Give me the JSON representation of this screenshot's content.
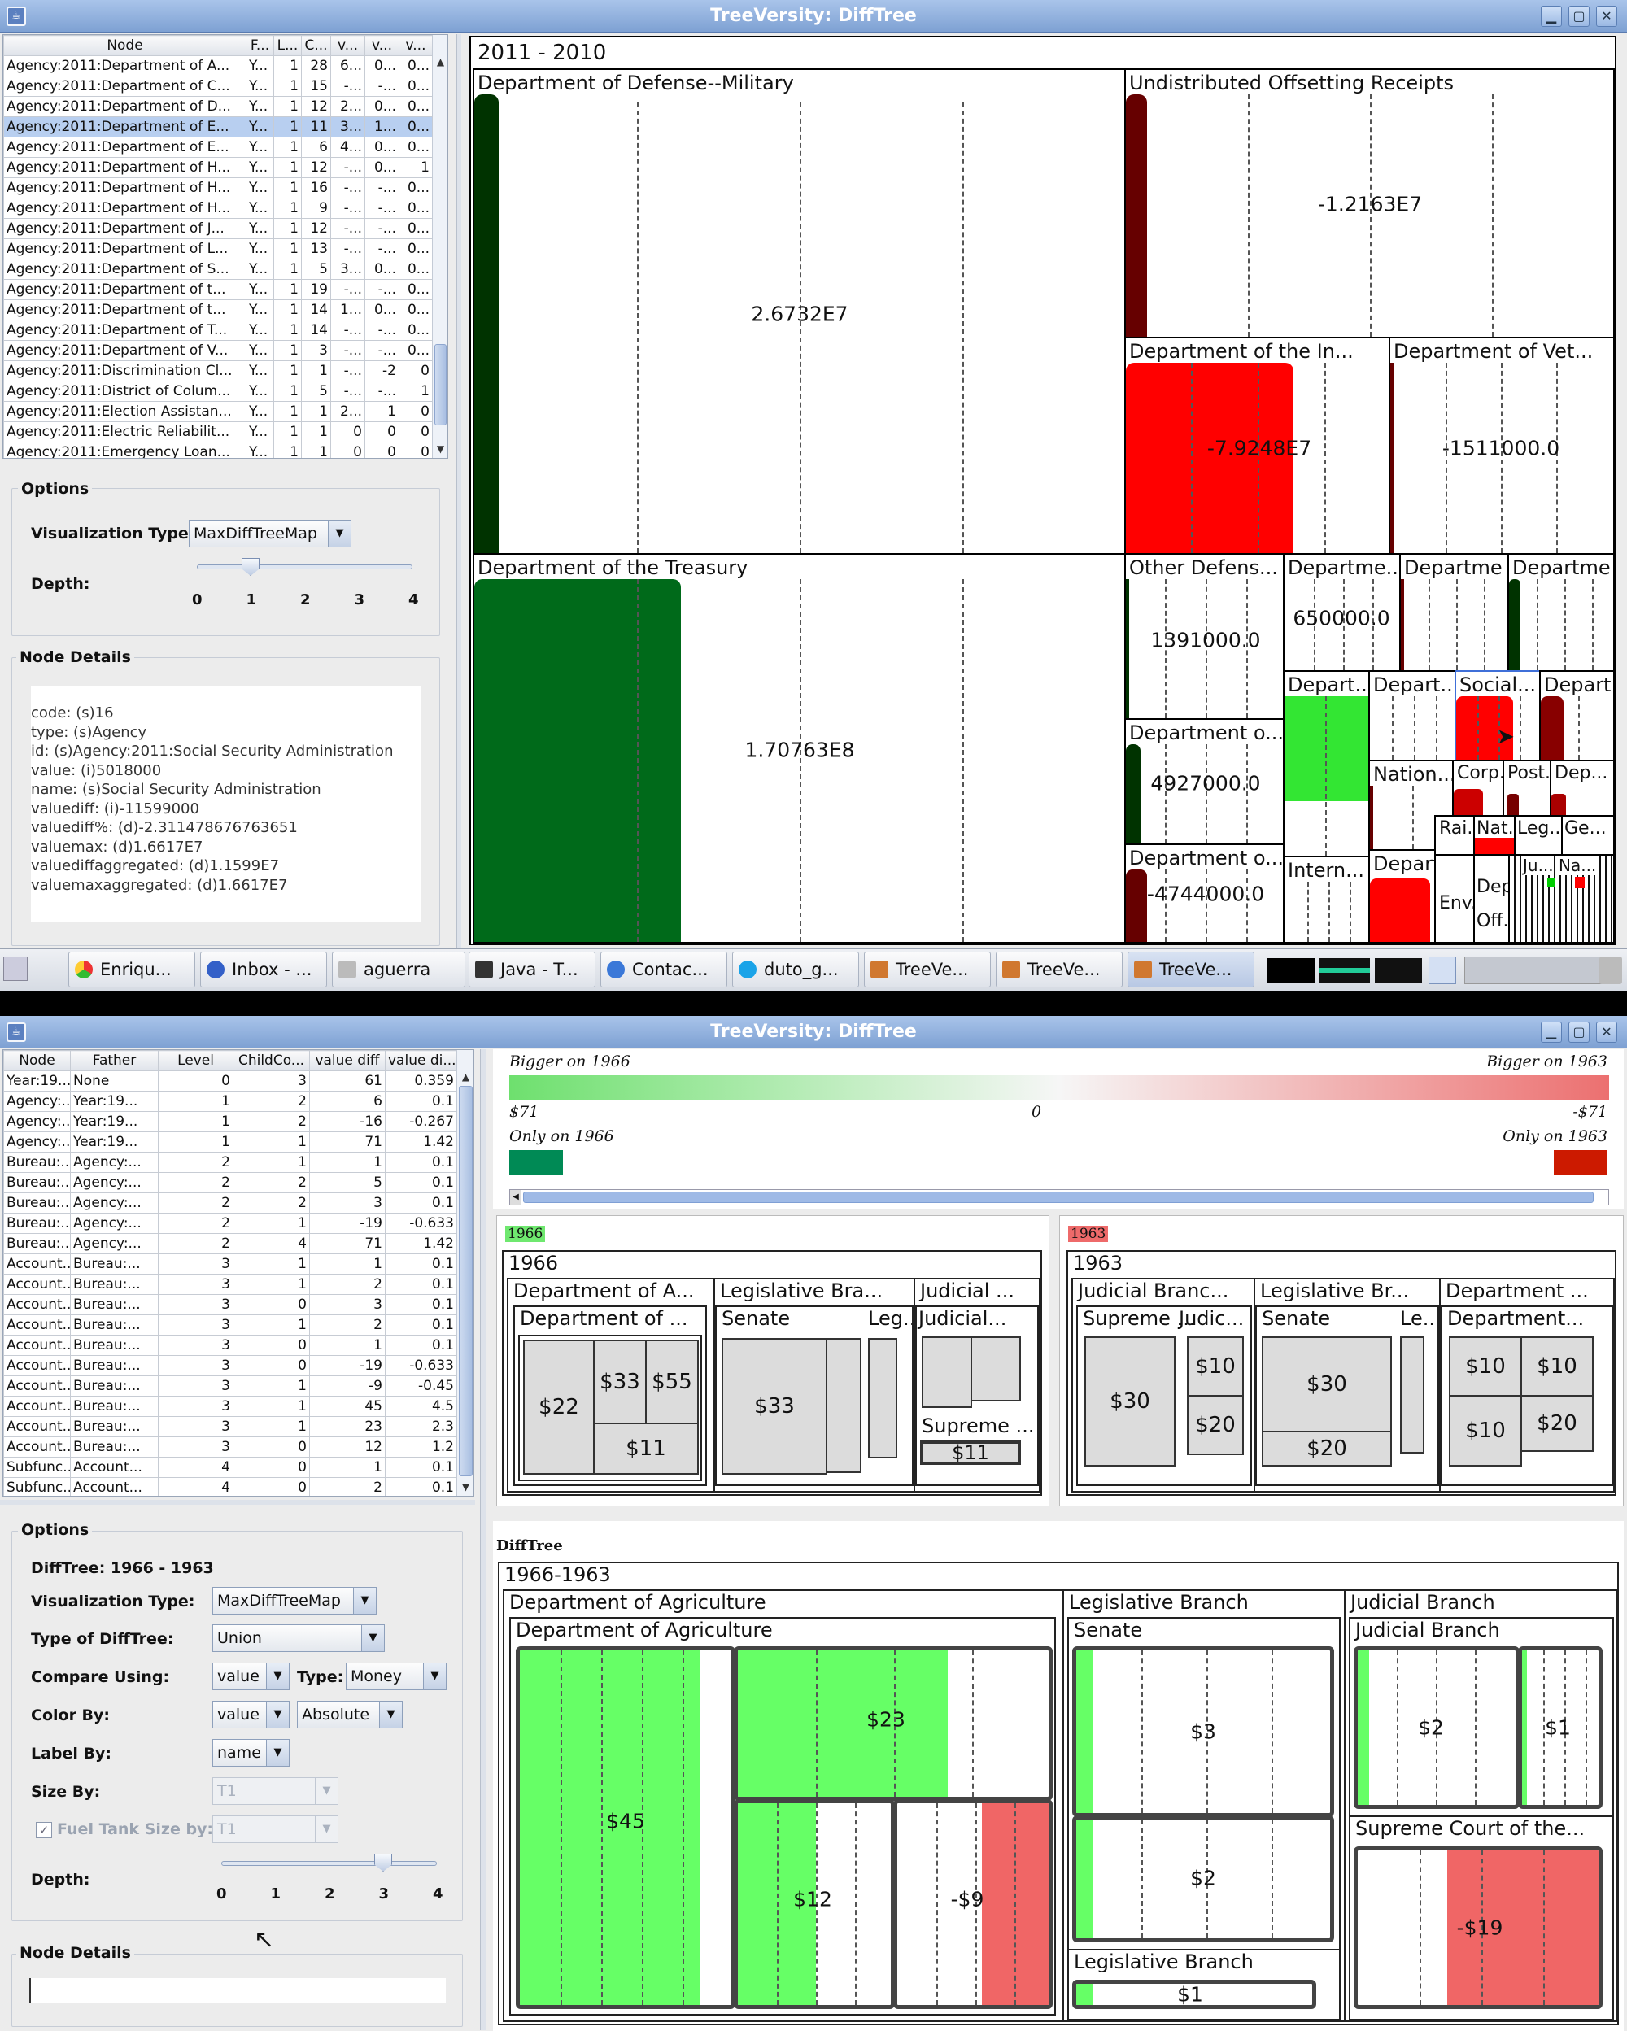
{
  "top_window": {
    "title": "TreeVersity: DiffTree",
    "table": {
      "headers": [
        "Node",
        "F...",
        "L...",
        "C...",
        "v...",
        "v...",
        "v..."
      ],
      "rows": [
        [
          "Agency:2011:Department of A...",
          "Y...",
          "1",
          "28",
          "6...",
          "0...",
          "0..."
        ],
        [
          "Agency:2011:Department of C...",
          "Y...",
          "1",
          "15",
          "-...",
          "-...",
          "0..."
        ],
        [
          "Agency:2011:Department of D...",
          "Y...",
          "1",
          "12",
          "2...",
          "0...",
          "0..."
        ],
        [
          "Agency:2011:Department of E...",
          "Y...",
          "1",
          "11",
          "3...",
          "1...",
          "0..."
        ],
        [
          "Agency:2011:Department of E...",
          "Y...",
          "1",
          "6",
          "4...",
          "0...",
          "0..."
        ],
        [
          "Agency:2011:Department of H...",
          "Y...",
          "1",
          "12",
          "-...",
          "0...",
          "1"
        ],
        [
          "Agency:2011:Department of H...",
          "Y...",
          "1",
          "16",
          "-...",
          "-...",
          "0..."
        ],
        [
          "Agency:2011:Department of H...",
          "Y...",
          "1",
          "9",
          "-...",
          "-...",
          "0..."
        ],
        [
          "Agency:2011:Department of J...",
          "Y...",
          "1",
          "12",
          "-...",
          "-...",
          "0..."
        ],
        [
          "Agency:2011:Department of L...",
          "Y...",
          "1",
          "13",
          "-...",
          "-...",
          "0..."
        ],
        [
          "Agency:2011:Department of S...",
          "Y...",
          "1",
          "5",
          "3...",
          "0...",
          "0..."
        ],
        [
          "Agency:2011:Department of t...",
          "Y...",
          "1",
          "19",
          "-...",
          "-...",
          "0..."
        ],
        [
          "Agency:2011:Department of t...",
          "Y...",
          "1",
          "14",
          "1...",
          "0...",
          "0..."
        ],
        [
          "Agency:2011:Department of T...",
          "Y...",
          "1",
          "14",
          "-...",
          "-...",
          "0..."
        ],
        [
          "Agency:2011:Department of V...",
          "Y...",
          "1",
          "3",
          "-...",
          "-...",
          "0..."
        ],
        [
          "Agency:2011:Discrimination Cl...",
          "Y...",
          "1",
          "1",
          "-...",
          "-2",
          "0"
        ],
        [
          "Agency:2011:District of Colum...",
          "Y...",
          "1",
          "5",
          "-...",
          "-...",
          "1"
        ],
        [
          "Agency:2011:Election Assistan...",
          "Y...",
          "1",
          "1",
          "2...",
          "1",
          "0"
        ],
        [
          "Agency:2011:Electric Reliabilit...",
          "Y...",
          "1",
          "1",
          "0",
          "0",
          "0"
        ],
        [
          "Agency:2011:Emergency Loan...",
          "Y...",
          "1",
          "1",
          "0",
          "0",
          "0"
        ]
      ]
    },
    "options": {
      "title": "Options",
      "vis_label": "Visualization Type:",
      "vis_value": "MaxDiffTreeMap",
      "depth_label": "Depth:",
      "depth_ticks": [
        "0",
        "1",
        "2",
        "3",
        "4"
      ],
      "depth_value": 1
    },
    "details": {
      "title": "Node Details",
      "lines": [
        "code: (s)16",
        "type: (s)Agency",
        "id: (s)Agency:2011:Social Security Administration",
        "value: (i)5018000",
        "name: (s)Social Security Administration",
        "valuediff: (i)-11599000",
        "valuediff%: (d)-2.311478676763651",
        "valuemax: (d)1.6617E7",
        "valuediffaggregated: (d)1.1599E7",
        "valuemaxaggregated: (d)1.6617E7"
      ]
    },
    "treemap": {
      "root": "2011 - 2010",
      "nodes": {
        "defense": {
          "label": "Department of Defense--Military",
          "value": "2.6732E7"
        },
        "undist": {
          "label": "Undistributed Offsetting Receipts",
          "value": "-1.2163E7"
        },
        "interior": {
          "label": "Department of the In...",
          "value": "-7.9248E7"
        },
        "veterans": {
          "label": "Department of Vet...",
          "value": "-1511000.0"
        },
        "treasury": {
          "label": "Department of the Treasury",
          "value": "1.70763E8"
        },
        "otherdef": {
          "label": "Other Defens...",
          "value": "1391000.0"
        },
        "dept_a": {
          "label": "Departme...",
          "value": "650000.0"
        },
        "dept_b": {
          "label": "Departme",
          "value": ""
        },
        "dept_c": {
          "label": "Departme",
          "value": ""
        },
        "dept_o1": {
          "label": "Department o...",
          "value": "4927000.0"
        },
        "dept_o2": {
          "label": "Department o...",
          "value": "-4744000.0"
        },
        "depart1": {
          "label": "Depart...",
          "value": ""
        },
        "depart2": {
          "label": "Depart...",
          "value": ""
        },
        "social": {
          "label": "Social...",
          "value": ""
        },
        "depart3": {
          "label": "Depart",
          "value": ""
        },
        "intern": {
          "label": "Intern...",
          "value": ""
        },
        "nation": {
          "label": "Nation...",
          "value": ""
        },
        "corp": {
          "label": "Corp...",
          "value": ""
        },
        "post": {
          "label": "Post...",
          "value": ""
        },
        "dep": {
          "label": "Dep...",
          "value": ""
        },
        "depart4": {
          "label": "Depart...",
          "value": ""
        },
        "rai": {
          "label": "Rai...",
          "value": ""
        },
        "nat": {
          "label": "Nat...",
          "value": ""
        },
        "leg": {
          "label": "Leg...",
          "value": ""
        },
        "ge": {
          "label": "Ge...",
          "value": ""
        },
        "env": {
          "label": "Env...",
          "value": ""
        },
        "dep2": {
          "label": "Dep...",
          "value": ""
        },
        "off": {
          "label": "Off...",
          "value": ""
        },
        "ju": {
          "label": "Ju...",
          "value": ""
        },
        "na": {
          "label": "Na...",
          "value": ""
        }
      }
    }
  },
  "taskbar": {
    "items": [
      "Enriqu...",
      "Inbox - ...",
      "aguerra",
      "Java - T...",
      "Contac...",
      "duto_g...",
      "TreeVe...",
      "TreeVe...",
      "TreeVe..."
    ]
  },
  "bottom_window": {
    "title": "TreeVersity: DiffTree",
    "table": {
      "headers": [
        "Node",
        "Father",
        "Level",
        "ChildCo...",
        "value diff",
        "value di..."
      ],
      "rows": [
        [
          "Year:19...",
          "None",
          "0",
          "3",
          "61",
          "0.359"
        ],
        [
          "Agency:...",
          "Year:19...",
          "1",
          "2",
          "6",
          "0.1"
        ],
        [
          "Agency:...",
          "Year:19...",
          "1",
          "2",
          "-16",
          "-0.267"
        ],
        [
          "Agency:...",
          "Year:19...",
          "1",
          "1",
          "71",
          "1.42"
        ],
        [
          "Bureau:...",
          "Agency:...",
          "2",
          "1",
          "1",
          "0.1"
        ],
        [
          "Bureau:...",
          "Agency:...",
          "2",
          "2",
          "5",
          "0.1"
        ],
        [
          "Bureau:...",
          "Agency:...",
          "2",
          "2",
          "3",
          "0.1"
        ],
        [
          "Bureau:...",
          "Agency:...",
          "2",
          "1",
          "-19",
          "-0.633"
        ],
        [
          "Bureau:...",
          "Agency:...",
          "2",
          "4",
          "71",
          "1.42"
        ],
        [
          "Account...",
          "Bureau:...",
          "3",
          "1",
          "1",
          "0.1"
        ],
        [
          "Account...",
          "Bureau:...",
          "3",
          "1",
          "2",
          "0.1"
        ],
        [
          "Account...",
          "Bureau:...",
          "3",
          "0",
          "3",
          "0.1"
        ],
        [
          "Account...",
          "Bureau:...",
          "3",
          "1",
          "2",
          "0.1"
        ],
        [
          "Account...",
          "Bureau:...",
          "3",
          "0",
          "1",
          "0.1"
        ],
        [
          "Account...",
          "Bureau:...",
          "3",
          "0",
          "-19",
          "-0.633"
        ],
        [
          "Account...",
          "Bureau:...",
          "3",
          "1",
          "-9",
          "-0.45"
        ],
        [
          "Account...",
          "Bureau:...",
          "3",
          "1",
          "45",
          "4.5"
        ],
        [
          "Account...",
          "Bureau:...",
          "3",
          "1",
          "23",
          "2.3"
        ],
        [
          "Account...",
          "Bureau:...",
          "3",
          "0",
          "12",
          "1.2"
        ],
        [
          "Subfunc...",
          "Account...",
          "4",
          "0",
          "1",
          "0.1"
        ],
        [
          "Subfunc...",
          "Account...",
          "4",
          "0",
          "2",
          "0.1"
        ]
      ]
    },
    "options": {
      "title": "Options",
      "difftree_label": "DiffTree: 1966 - 1963",
      "vis_label": "Visualization Type:",
      "vis_value": "MaxDiffTreeMap",
      "type_label": "Type of DiffTree:",
      "type_value": "Union",
      "compare_label": "Compare Using:",
      "compare_value": "value",
      "type2_label": "Type:",
      "type2_value": "Money",
      "color_label": "Color By:",
      "color_value": "value",
      "color_mode": "Absolute",
      "labelby_label": "Label By:",
      "labelby_value": "name",
      "sizeby_label": "Size By:",
      "sizeby_value": "T1",
      "fuel_label": "Fuel Tank Size by:",
      "fuel_value": "T1",
      "depth_label": "Depth:",
      "depth_ticks": [
        "0",
        "1",
        "2",
        "3",
        "4"
      ],
      "depth_value": 3
    },
    "details": {
      "title": "Node Details"
    },
    "legend": {
      "bigger_left": "Bigger on 1966",
      "bigger_right": "Bigger on 1963",
      "min": "$71",
      "mid": "0",
      "max": "-$71",
      "only_left": "Only on 1966",
      "only_right": "Only on 1963",
      "color_green": "#008a55",
      "color_red": "#cc1a00"
    },
    "y1966": {
      "badge": "1966",
      "title": "1966",
      "agri": "Department of A...",
      "agri_inner": "Department of ...",
      "v22": "$22",
      "v33": "$33",
      "v55": "$55",
      "v11": "$11",
      "legis": "Legislative Bra...",
      "senate": "Senate",
      "leg": "Leg...",
      "sen33": "$33",
      "judicial": "Judicial ...",
      "judicial_inner": "Judicial...",
      "supreme": "Supreme ...",
      "sup11": "$11"
    },
    "y1963": {
      "badge": "1963",
      "title": "1963",
      "judicial": "Judicial Branc...",
      "supreme": "Supreme ...",
      "judic": "Judic...",
      "v30": "$30",
      "v10": "$10",
      "v20": "$20",
      "legis": "Legislative Br...",
      "senate": "Senate",
      "le": "Le...",
      "s30": "$30",
      "s20": "$20",
      "dept": "Department ...",
      "dept_inner": "Department...",
      "d10a": "$10",
      "d10b": "$10",
      "d10c": "$10",
      "d20": "$20"
    },
    "difftree": {
      "panel_title": "DiffTree",
      "root": "1966-1963",
      "agri": "Department of Agriculture",
      "agri_inner": "Department of Agriculture",
      "a45": "$45",
      "a23": "$23",
      "a12": "$12",
      "a9": "-$9",
      "legis": "Legislative Branch",
      "senate": "Senate",
      "s3": "$3",
      "s2": "$2",
      "legis_inner": "Legislative Branch",
      "l1": "$1",
      "judicial": "Judicial Branch",
      "judicial_inner": "Judicial Branch",
      "j2": "$2",
      "j1": "$1",
      "supreme": "Supreme Court of the...",
      "sup19": "-$19"
    }
  }
}
